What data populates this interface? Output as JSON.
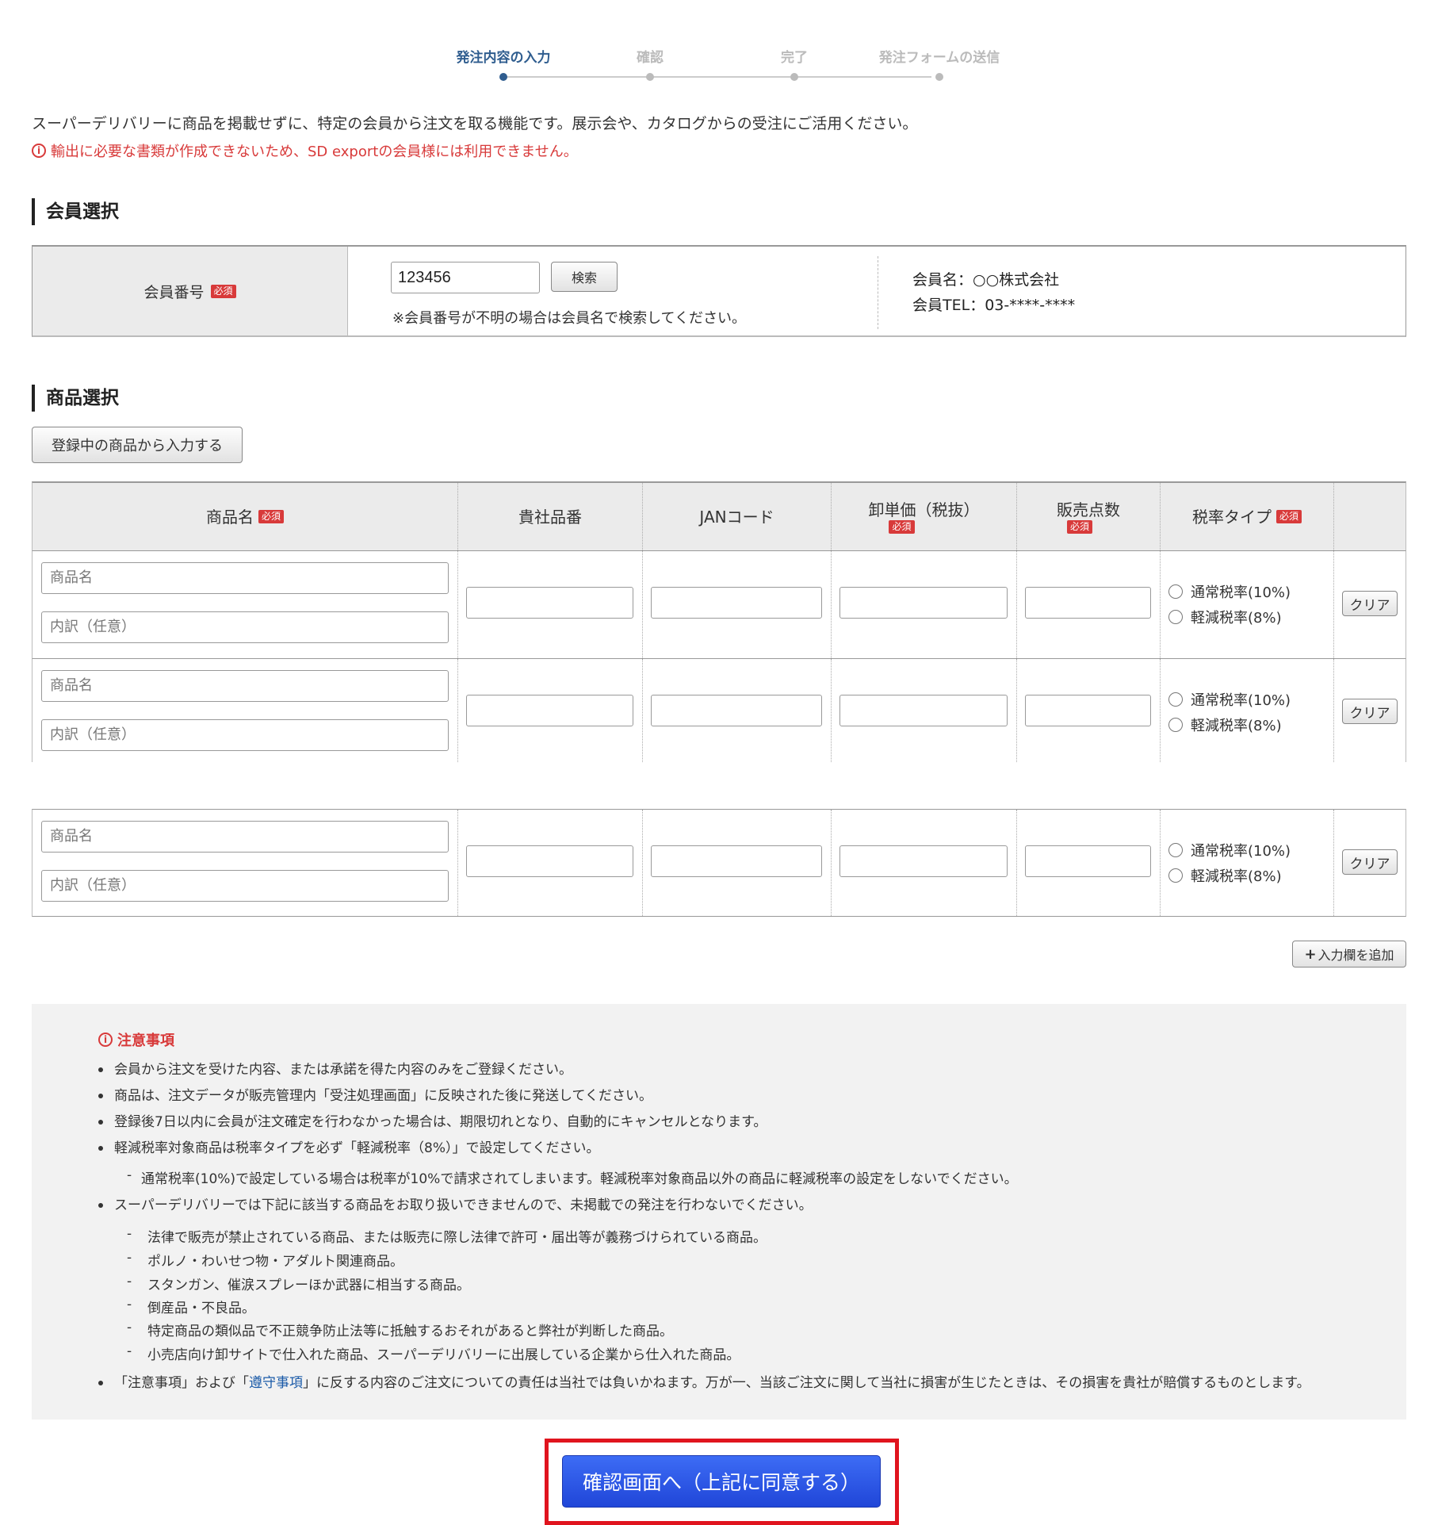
{
  "stepper": {
    "steps": [
      {
        "label": "発注内容の入力",
        "active": true
      },
      {
        "label": "確認",
        "active": false
      },
      {
        "label": "完了",
        "active": false
      },
      {
        "label": "発注フォームの送信",
        "active": false
      }
    ]
  },
  "intro": "スーパーデリバリーに商品を掲載せずに、特定の会員から注文を取る機能です。展示会や、カタログからの受注にご活用ください。",
  "warning": "輸出に必要な書類が作成できないため、SD exportの会員様には利用できません。",
  "member_section": {
    "title": "会員選択",
    "label": "会員番号",
    "required": "必須",
    "member_number": "123456",
    "search_button": "検索",
    "note": "※会員番号が不明の場合は会員名で検索してください。",
    "member_name": "会員名：○○株式会社",
    "member_tel": "会員TEL：03-****-****"
  },
  "product_section": {
    "title": "商品選択",
    "add_from_registered": "登録中の商品から入力する",
    "headers": {
      "name": "商品名",
      "item_no": "貴社品番",
      "jan": "JANコード",
      "wholesale": "卸単価（税抜）",
      "qty": "販売点数",
      "tax_type": "税率タイプ"
    },
    "required": "必須",
    "rows": [
      {
        "name_ph": "商品名",
        "detail_ph": "内訳（任意）",
        "tax1": "通常税率(10%)",
        "tax2": "軽減税率(8%)",
        "clear": "クリア"
      },
      {
        "name_ph": "商品名",
        "detail_ph": "内訳（任意）",
        "tax1": "通常税率(10%)",
        "tax2": "軽減税率(8%)",
        "clear": "クリア"
      },
      {
        "name_ph": "商品名",
        "detail_ph": "内訳（任意）",
        "tax1": "通常税率(10%)",
        "tax2": "軽減税率(8%)",
        "clear": "クリア"
      }
    ],
    "add_row": "入力欄を追加"
  },
  "notes": {
    "title": "注意事項",
    "items": [
      "会員から注文を受けた内容、または承諾を得た内容のみをご登録ください。",
      "商品は、注文データが販売管理内「受注処理画面」に反映された後に発送してください。",
      "登録後7日以内に会員が注文確定を行わなかった場合は、期限切れとなり、自動的にキャンセルとなります。",
      "軽減税率対象商品は税率タイプを必ず「軽減税率（8%）」で設定してください。"
    ],
    "sub_tax": "通常税率(10%)で設定している場合は税率が10%で請求されてしまいます。軽減税率対象商品以外の商品に軽減税率の設定をしないでください。",
    "prohibited_intro": "スーパーデリバリーでは下記に該当する商品をお取り扱いできませんので、未掲載での発注を行わないでください。",
    "prohibited": [
      "法律で販売が禁止されている商品、または販売に際し法律で許可・届出等が義務づけられている商品。",
      "ポルノ・わいせつ物・アダルト関連商品。",
      "スタンガン、催涙スプレーほか武器に相当する商品。",
      "倒産品・不良品。",
      "特定商品の類似品で不正競争防止法等に抵触するおそれがあると弊社が判断した商品。",
      "小売店向け卸サイトで仕入れた商品、スーパーデリバリーに出展している企業から仕入れた商品。"
    ],
    "last_pre": "「注意事項」および「",
    "last_link": "遵守事項",
    "last_post": "」に反する内容のご注文についての責任は当社では負いかねます。万が一、当該ご注文に関して当社に損害が生じたときは、その損害を貴社が賠償するものとします。"
  },
  "confirm_button": "確認画面へ（上記に同意する）"
}
